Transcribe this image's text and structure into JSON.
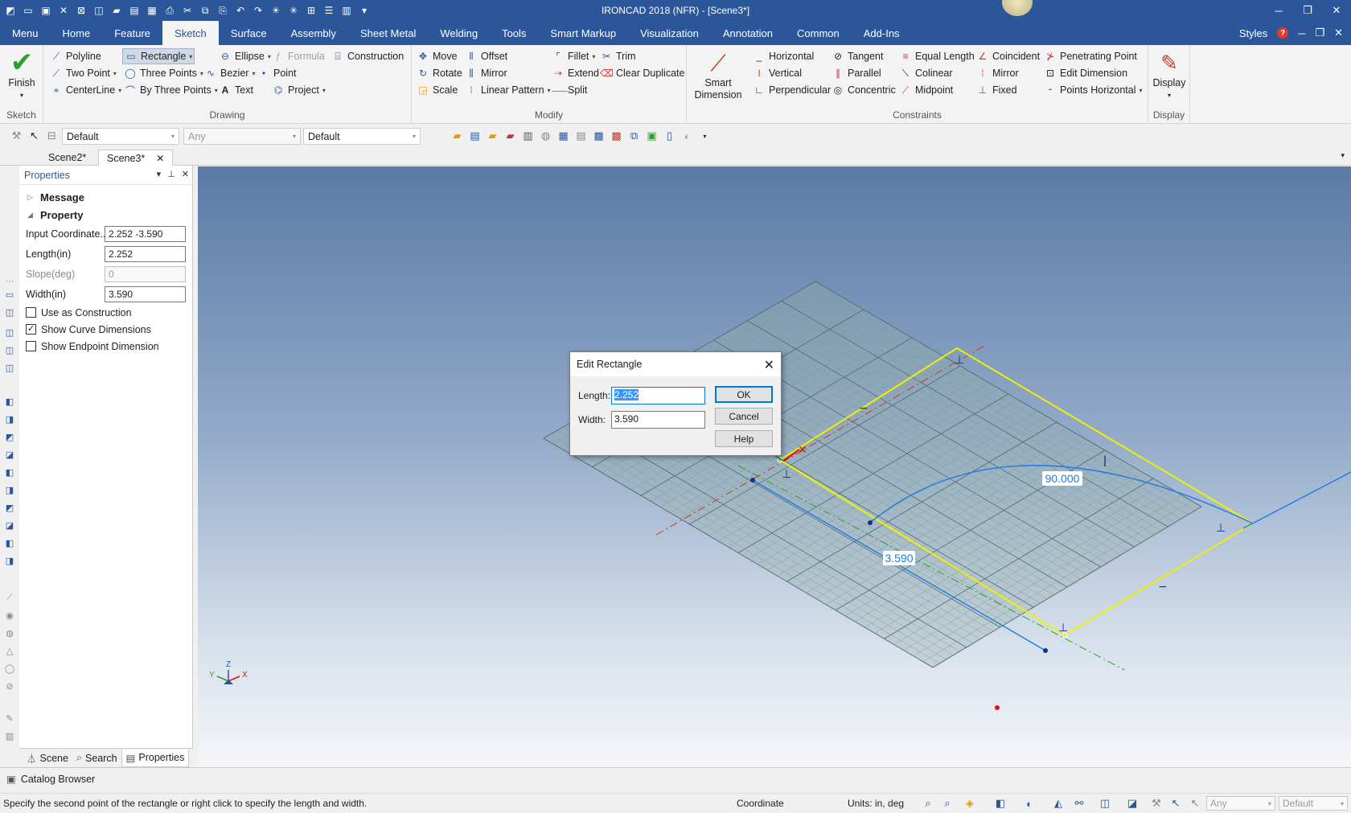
{
  "app": {
    "title": "IRONCAD 2018 (NFR) - [Scene3*]",
    "styles_label": "Styles",
    "help_glyph": "?"
  },
  "menu_tabs": [
    "Menu",
    "Home",
    "Feature",
    "Sketch",
    "Surface",
    "Assembly",
    "Sheet Metal",
    "Welding",
    "Tools",
    "Smart Markup",
    "Visualization",
    "Annotation",
    "Common",
    "Add-Ins"
  ],
  "active_tab": "Sketch",
  "ribbon": {
    "finish": {
      "label": "Finish",
      "group": "Sketch"
    },
    "drawing": {
      "group": "Drawing",
      "polyline": "Polyline",
      "rectangle": "Rectangle",
      "ellipse": "Ellipse",
      "formula": "Formula",
      "construction": "Construction",
      "two_point": "Two Point",
      "three_points": "Three Points",
      "bezier": "Bezier",
      "point": "Point",
      "centerline": "CenterLine",
      "by_three_points": "By Three Points",
      "text": "Text",
      "project": "Project"
    },
    "modify": {
      "group": "Modify",
      "move": "Move",
      "offset": "Offset",
      "fillet": "Fillet",
      "trim": "Trim",
      "rotate": "Rotate",
      "mirror": "Mirror",
      "extend": "Extend",
      "clear_duplicate": "Clear Duplicate",
      "scale": "Scale",
      "linear_pattern": "Linear Pattern",
      "split": "Split"
    },
    "constraints": {
      "group": "Constraints",
      "smart_dimension": "Smart Dimension",
      "horizontal": "Horizontal",
      "tangent": "Tangent",
      "equal_length": "Equal Length",
      "coincident": "Coincident",
      "penetrating_point": "Penetrating Point",
      "vertical": "Vertical",
      "parallel": "Parallel",
      "colinear": "Colinear",
      "mirror": "Mirror",
      "edit_dimension": "Edit Dimension",
      "perpendicular": "Perpendicular",
      "concentric": "Concentric",
      "midpoint": "Midpoint",
      "fixed": "Fixed",
      "points_horizontal": "Points Horizontal"
    },
    "display": {
      "label": "Display",
      "group": "Display"
    }
  },
  "toolbar2": {
    "combo1": "Default",
    "combo2": "Any",
    "combo3": "Default"
  },
  "doc_tabs": [
    "Scene2*",
    "Scene3*"
  ],
  "properties": {
    "title": "Properties",
    "message_section": "Message",
    "property_section": "Property",
    "rows": [
      {
        "label": "Input Coordinate...",
        "value": "2.252 -3.590"
      },
      {
        "label": "Length(in)",
        "value": "2.252"
      },
      {
        "label": "Slope(deg)",
        "value": "0"
      },
      {
        "label": "Width(in)",
        "value": "3.590"
      }
    ],
    "checks": [
      {
        "label": "Use as Construction",
        "checked": false
      },
      {
        "label": "Show Curve Dimensions",
        "checked": true
      },
      {
        "label": "Show Endpoint Dimension",
        "checked": false
      }
    ],
    "panel_tabs": [
      "Scene",
      "Search",
      "Properties"
    ]
  },
  "viewport": {
    "dim_angle": "90.000",
    "dim_width": "3.590",
    "triad": {
      "x": "X",
      "y": "Y",
      "z": "Z"
    }
  },
  "dialog": {
    "title": "Edit Rectangle",
    "length_label": "Length:",
    "length_value": "2.252",
    "width_label": "Width:",
    "width_value": "3.590",
    "ok": "OK",
    "cancel": "Cancel",
    "help": "Help"
  },
  "catalog_browser": "Catalog Browser",
  "status": {
    "message": "Specify the second point of the rectangle or right click to specify the length and width.",
    "coordinate": "Coordinate",
    "units": "Units: in, deg",
    "combo1": "Any",
    "combo2": "Default"
  }
}
